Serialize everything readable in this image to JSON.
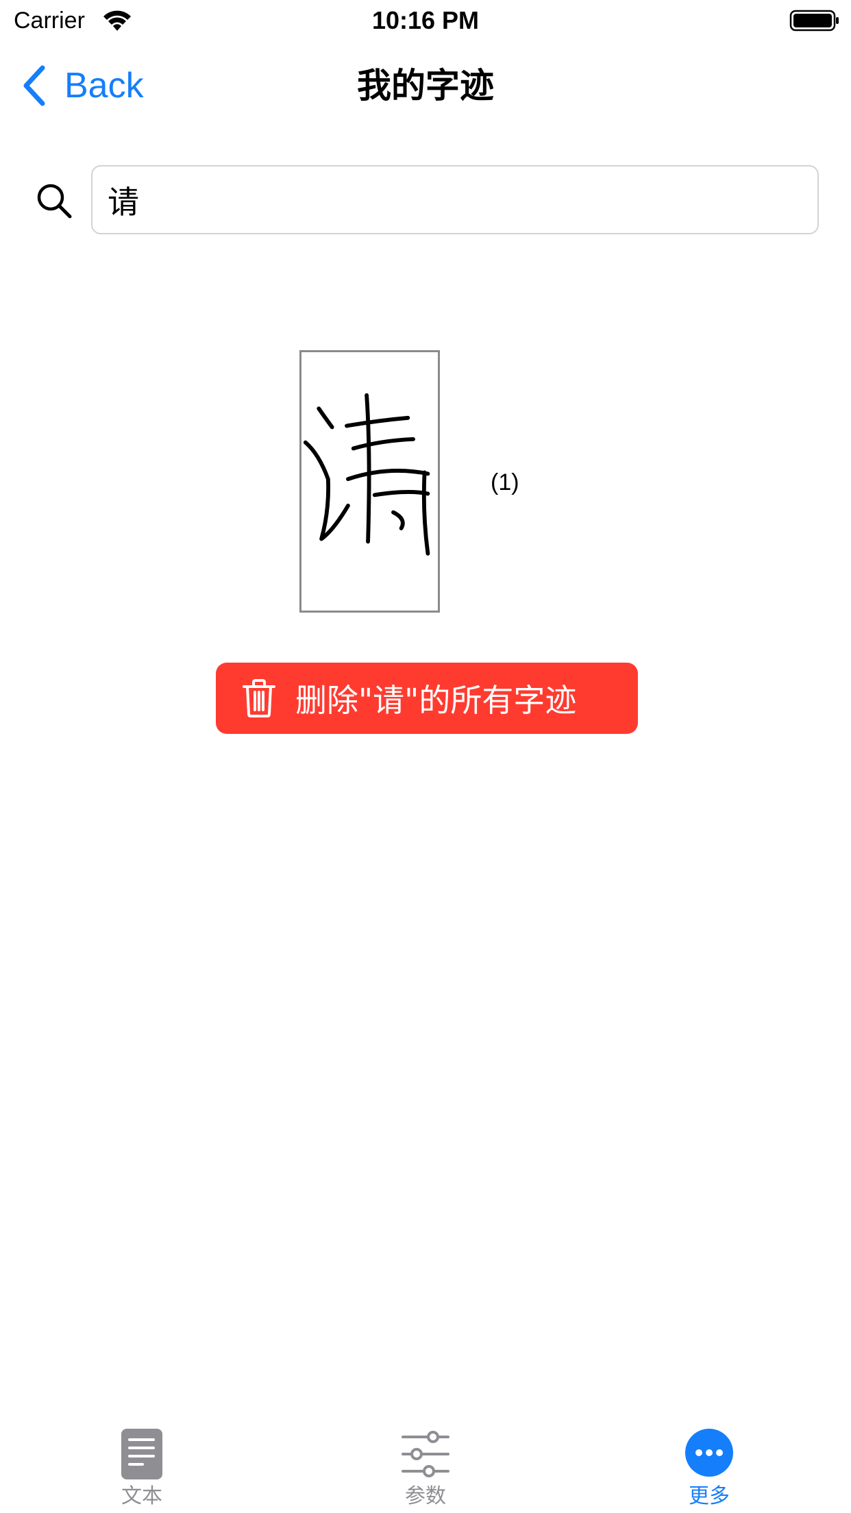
{
  "status_bar": {
    "carrier": "Carrier",
    "time": "10:16 PM"
  },
  "nav": {
    "back_label": "Back",
    "title": "我的字迹"
  },
  "search": {
    "value": "请"
  },
  "glyph": {
    "count": "(1)"
  },
  "delete_button": {
    "label": "删除\"请\"的所有字迹"
  },
  "tabs": [
    {
      "label": "文本",
      "icon": "document-icon",
      "active": false
    },
    {
      "label": "参数",
      "icon": "sliders-icon",
      "active": false
    },
    {
      "label": "更多",
      "icon": "more-icon",
      "active": true
    }
  ],
  "colors": {
    "accent": "#157efb",
    "danger": "#ff3b30",
    "inactive": "#8e8e93"
  }
}
